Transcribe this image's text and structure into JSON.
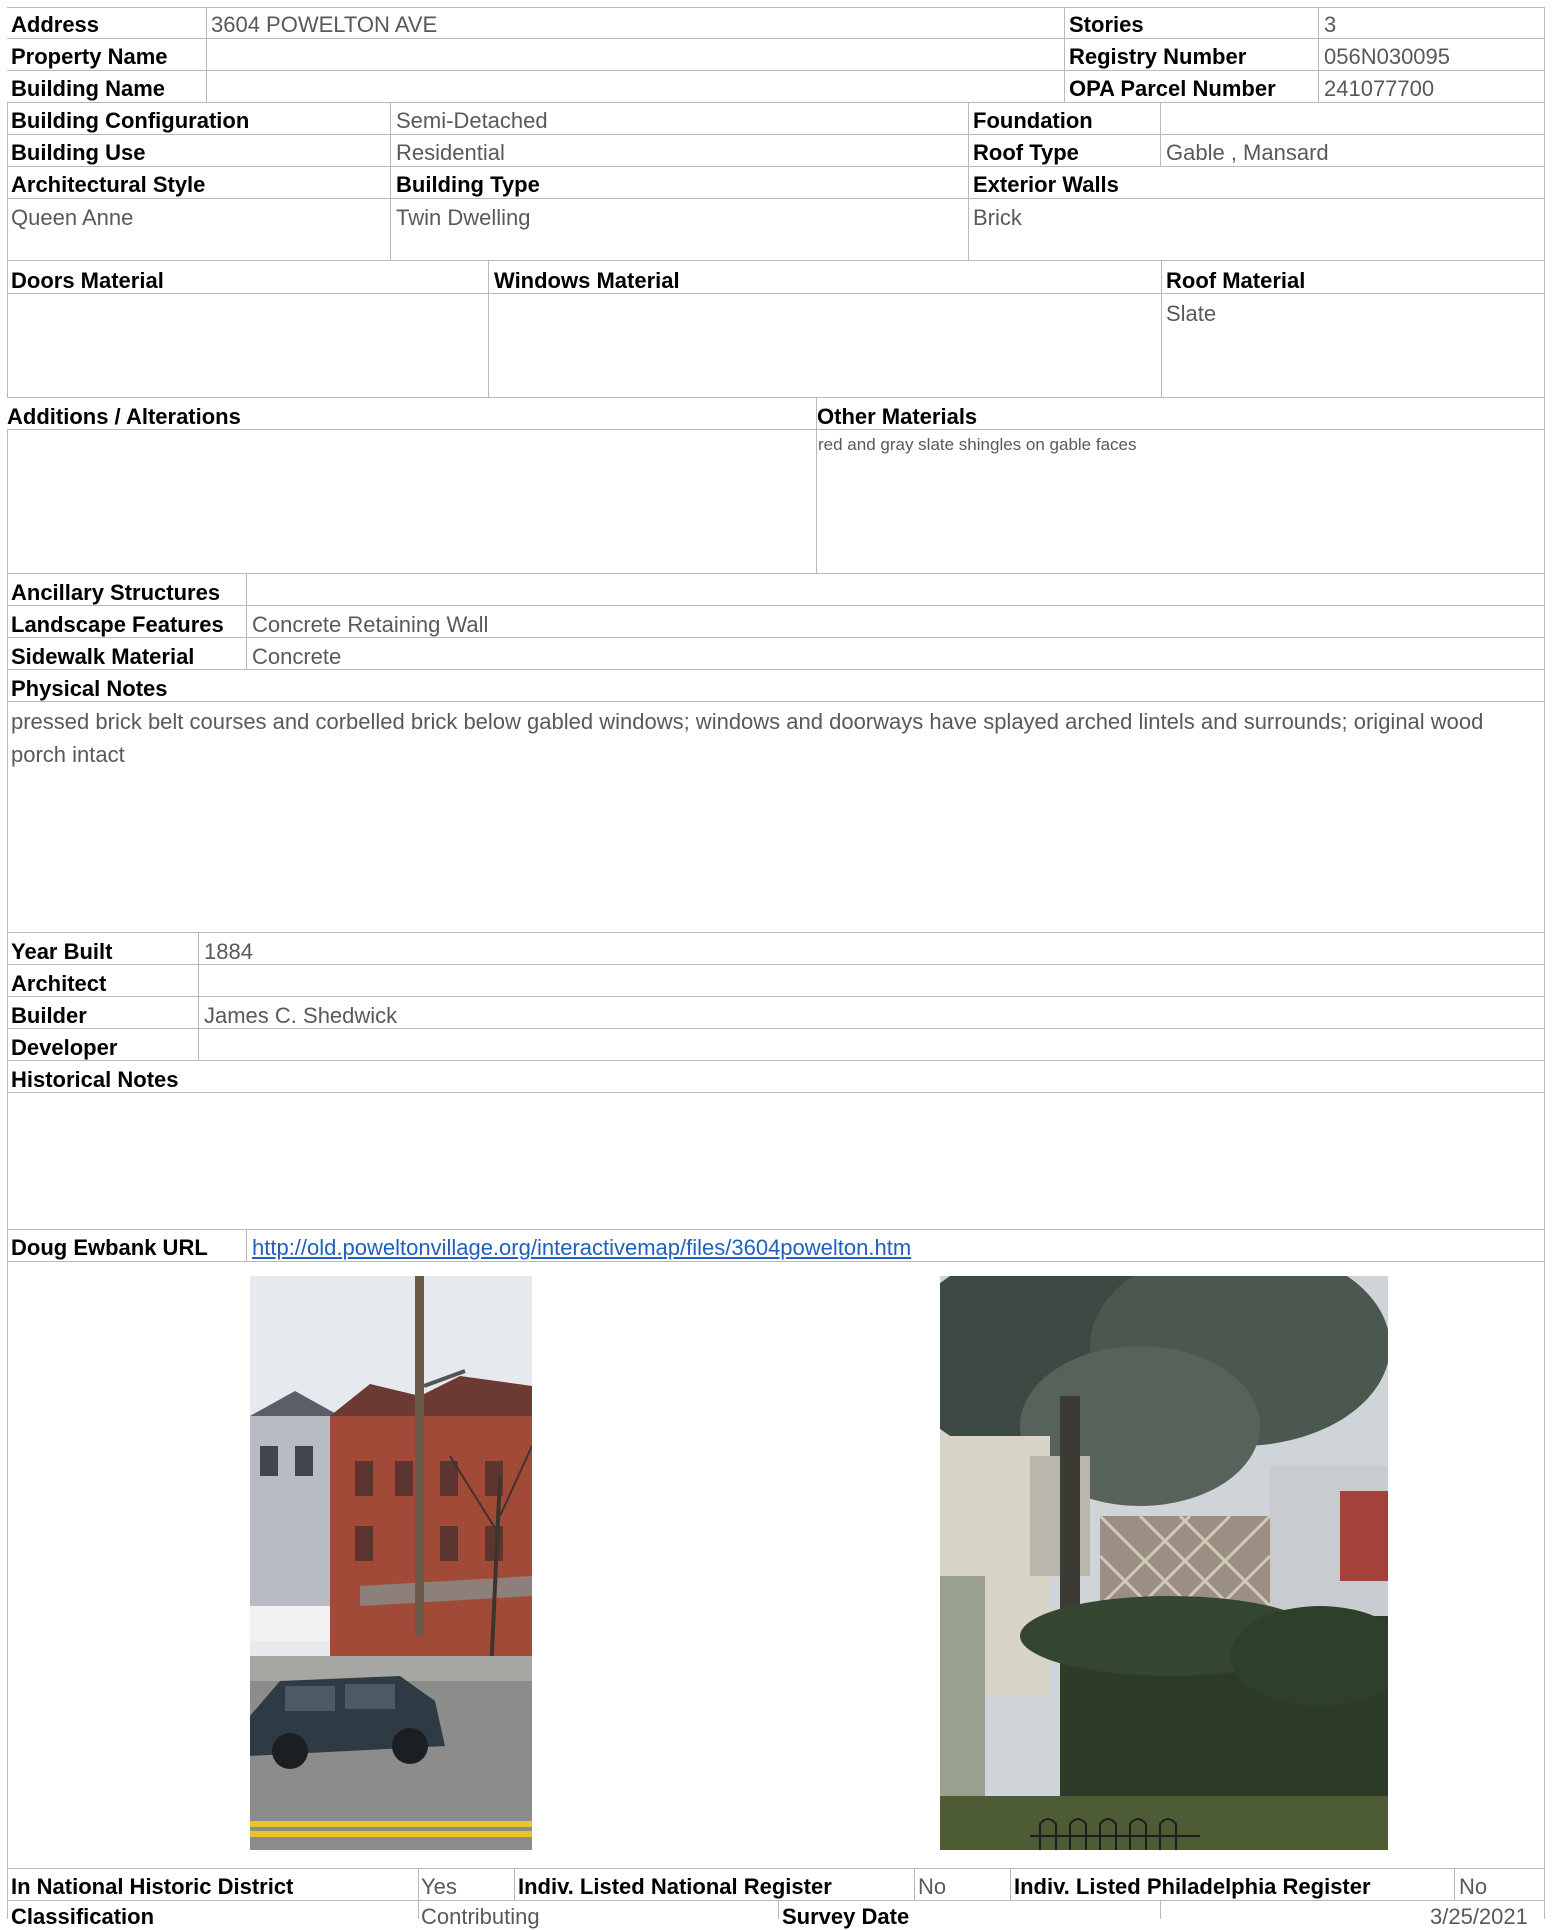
{
  "header": {
    "address_label": "Address",
    "address": "3604 POWELTON AVE",
    "stories_label": "Stories",
    "stories": "3",
    "property_name_label": "Property Name",
    "property_name": "",
    "registry_label": "Registry Number",
    "registry": "056N030095",
    "building_name_label": "Building Name",
    "building_name": "",
    "opa_label": "OPA Parcel Number",
    "opa": "241077700"
  },
  "building": {
    "config_label": "Building Configuration",
    "config": "Semi-Detached",
    "foundation_label": "Foundation",
    "foundation": "",
    "use_label": "Building Use",
    "use": "Residential",
    "roof_type_label": "Roof Type",
    "roof_type": "Gable , Mansard",
    "style_label": "Architectural Style",
    "style": "Queen Anne",
    "type_label": "Building Type",
    "type": "Twin Dwelling",
    "walls_label": "Exterior Walls",
    "walls": "Brick"
  },
  "materials": {
    "doors_label": "Doors Material",
    "doors": "",
    "windows_label": "Windows Material",
    "windows": "",
    "roof_label": "Roof Material",
    "roof": "Slate",
    "additions_label": "Additions / Alterations",
    "additions": "",
    "other_label": "Other Materials",
    "other": "red and gray slate shingles on gable faces"
  },
  "site": {
    "ancillary_label": "Ancillary Structures",
    "ancillary": "",
    "landscape_label": "Landscape Features",
    "landscape": "Concrete Retaining Wall",
    "sidewalk_label": "Sidewalk Material",
    "sidewalk": "Concrete",
    "physical_notes_label": "Physical Notes",
    "physical_notes": "pressed brick belt courses and corbelled brick below gabled windows; windows and doorways have splayed arched lintels and surrounds; original wood porch intact"
  },
  "history": {
    "year_label": "Year Built",
    "year": "1884",
    "architect_label": "Architect",
    "architect": "",
    "builder_label": "Builder",
    "builder": "James C. Shedwick",
    "developer_label": "Developer",
    "developer": "",
    "notes_label": "Historical Notes",
    "notes": "",
    "url_label": "Doug Ewbank URL",
    "url": "http://old.poweltonvillage.org/interactivemap/files/3604powelton.htm"
  },
  "photos": [
    "street-view-photo",
    "rear-view-photo"
  ],
  "footer": {
    "district_label": "In National Historic District",
    "district": "Yes",
    "national_label": "Indiv. Listed National Register",
    "national": "No",
    "phila_label": "Indiv. Listed Philadelphia Register",
    "phila": "No",
    "class_label": "Classification",
    "class": "Contributing",
    "survey_label": "Survey Date",
    "survey": "3/25/2021"
  },
  "colors": {
    "grid": "#b9b9b9",
    "value_text": "#595959",
    "link": "#1f5fbf"
  }
}
